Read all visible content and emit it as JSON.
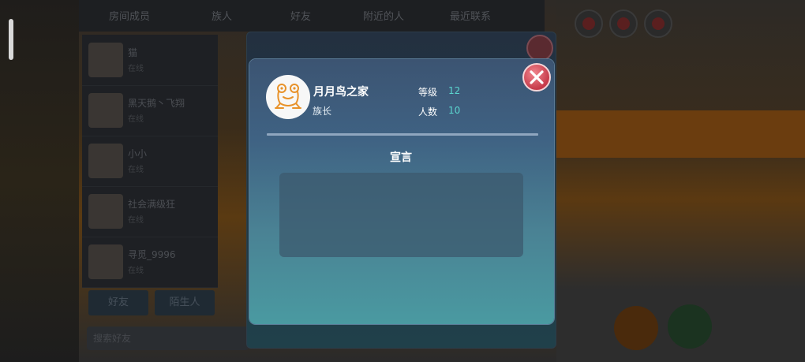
{
  "background": {
    "tabs": [
      "房间成员",
      "族人",
      "好友",
      "附近的人",
      "最近联系"
    ],
    "friends": [
      {
        "name": "猫",
        "status": "在线"
      },
      {
        "name": "黑天鹅丶飞翔",
        "status": "在线"
      },
      {
        "name": "小小",
        "status": "在线"
      },
      {
        "name": "社会满级狂",
        "status": "在线"
      },
      {
        "name": "寻觅_9996",
        "status": "在线"
      }
    ],
    "buttons": [
      "好友",
      "陌生人"
    ],
    "search_placeholder": "搜索好友"
  },
  "clan_card": {
    "name": "月月鸟之家",
    "role": "族长",
    "level_label": "等级",
    "level_value": "12",
    "members_label": "人数",
    "members_value": "10",
    "declaration_title": "宣言",
    "declaration_text": "",
    "avatar_icon": "frog-icon",
    "close_icon": "close-icon",
    "accent_color": "#5bd6cf",
    "close_color": "#d94a5a"
  }
}
